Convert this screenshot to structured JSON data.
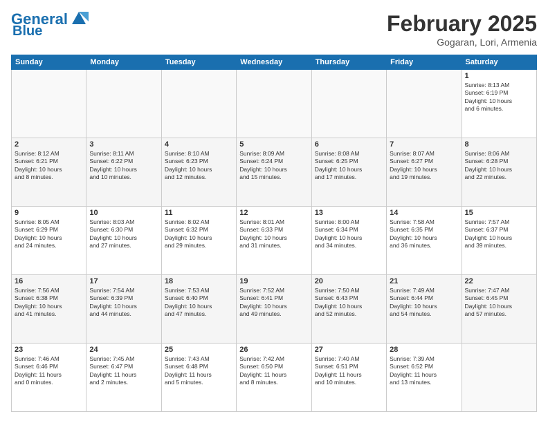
{
  "header": {
    "logo_line1": "General",
    "logo_line2": "Blue",
    "title": "February 2025",
    "subtitle": "Gogaran, Lori, Armenia"
  },
  "days_of_week": [
    "Sunday",
    "Monday",
    "Tuesday",
    "Wednesday",
    "Thursday",
    "Friday",
    "Saturday"
  ],
  "weeks": [
    [
      {
        "day": "",
        "info": ""
      },
      {
        "day": "",
        "info": ""
      },
      {
        "day": "",
        "info": ""
      },
      {
        "day": "",
        "info": ""
      },
      {
        "day": "",
        "info": ""
      },
      {
        "day": "",
        "info": ""
      },
      {
        "day": "1",
        "info": "Sunrise: 8:13 AM\nSunset: 6:19 PM\nDaylight: 10 hours\nand 6 minutes."
      }
    ],
    [
      {
        "day": "2",
        "info": "Sunrise: 8:12 AM\nSunset: 6:21 PM\nDaylight: 10 hours\nand 8 minutes."
      },
      {
        "day": "3",
        "info": "Sunrise: 8:11 AM\nSunset: 6:22 PM\nDaylight: 10 hours\nand 10 minutes."
      },
      {
        "day": "4",
        "info": "Sunrise: 8:10 AM\nSunset: 6:23 PM\nDaylight: 10 hours\nand 12 minutes."
      },
      {
        "day": "5",
        "info": "Sunrise: 8:09 AM\nSunset: 6:24 PM\nDaylight: 10 hours\nand 15 minutes."
      },
      {
        "day": "6",
        "info": "Sunrise: 8:08 AM\nSunset: 6:25 PM\nDaylight: 10 hours\nand 17 minutes."
      },
      {
        "day": "7",
        "info": "Sunrise: 8:07 AM\nSunset: 6:27 PM\nDaylight: 10 hours\nand 19 minutes."
      },
      {
        "day": "8",
        "info": "Sunrise: 8:06 AM\nSunset: 6:28 PM\nDaylight: 10 hours\nand 22 minutes."
      }
    ],
    [
      {
        "day": "9",
        "info": "Sunrise: 8:05 AM\nSunset: 6:29 PM\nDaylight: 10 hours\nand 24 minutes."
      },
      {
        "day": "10",
        "info": "Sunrise: 8:03 AM\nSunset: 6:30 PM\nDaylight: 10 hours\nand 27 minutes."
      },
      {
        "day": "11",
        "info": "Sunrise: 8:02 AM\nSunset: 6:32 PM\nDaylight: 10 hours\nand 29 minutes."
      },
      {
        "day": "12",
        "info": "Sunrise: 8:01 AM\nSunset: 6:33 PM\nDaylight: 10 hours\nand 31 minutes."
      },
      {
        "day": "13",
        "info": "Sunrise: 8:00 AM\nSunset: 6:34 PM\nDaylight: 10 hours\nand 34 minutes."
      },
      {
        "day": "14",
        "info": "Sunrise: 7:58 AM\nSunset: 6:35 PM\nDaylight: 10 hours\nand 36 minutes."
      },
      {
        "day": "15",
        "info": "Sunrise: 7:57 AM\nSunset: 6:37 PM\nDaylight: 10 hours\nand 39 minutes."
      }
    ],
    [
      {
        "day": "16",
        "info": "Sunrise: 7:56 AM\nSunset: 6:38 PM\nDaylight: 10 hours\nand 41 minutes."
      },
      {
        "day": "17",
        "info": "Sunrise: 7:54 AM\nSunset: 6:39 PM\nDaylight: 10 hours\nand 44 minutes."
      },
      {
        "day": "18",
        "info": "Sunrise: 7:53 AM\nSunset: 6:40 PM\nDaylight: 10 hours\nand 47 minutes."
      },
      {
        "day": "19",
        "info": "Sunrise: 7:52 AM\nSunset: 6:41 PM\nDaylight: 10 hours\nand 49 minutes."
      },
      {
        "day": "20",
        "info": "Sunrise: 7:50 AM\nSunset: 6:43 PM\nDaylight: 10 hours\nand 52 minutes."
      },
      {
        "day": "21",
        "info": "Sunrise: 7:49 AM\nSunset: 6:44 PM\nDaylight: 10 hours\nand 54 minutes."
      },
      {
        "day": "22",
        "info": "Sunrise: 7:47 AM\nSunset: 6:45 PM\nDaylight: 10 hours\nand 57 minutes."
      }
    ],
    [
      {
        "day": "23",
        "info": "Sunrise: 7:46 AM\nSunset: 6:46 PM\nDaylight: 11 hours\nand 0 minutes."
      },
      {
        "day": "24",
        "info": "Sunrise: 7:45 AM\nSunset: 6:47 PM\nDaylight: 11 hours\nand 2 minutes."
      },
      {
        "day": "25",
        "info": "Sunrise: 7:43 AM\nSunset: 6:48 PM\nDaylight: 11 hours\nand 5 minutes."
      },
      {
        "day": "26",
        "info": "Sunrise: 7:42 AM\nSunset: 6:50 PM\nDaylight: 11 hours\nand 8 minutes."
      },
      {
        "day": "27",
        "info": "Sunrise: 7:40 AM\nSunset: 6:51 PM\nDaylight: 11 hours\nand 10 minutes."
      },
      {
        "day": "28",
        "info": "Sunrise: 7:39 AM\nSunset: 6:52 PM\nDaylight: 11 hours\nand 13 minutes."
      },
      {
        "day": "",
        "info": ""
      }
    ]
  ]
}
